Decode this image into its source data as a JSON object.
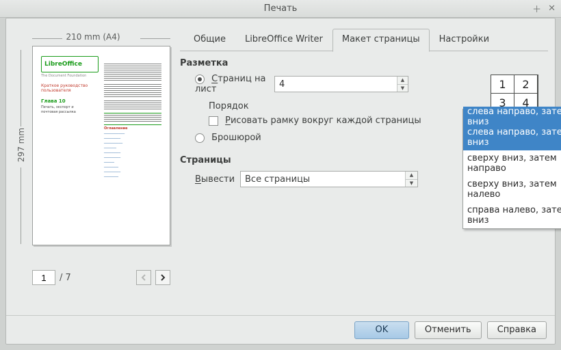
{
  "window": {
    "title": "Печать"
  },
  "preview": {
    "width_label": "210 mm (A4)",
    "height_label": "297 mm",
    "logo": "LibreOffice",
    "logo_sub": "The Document Foundation",
    "red_line": "Краткое руководство пользователя",
    "chapter": "Глава 10",
    "chapter_sub1": "Печать, экспорт и",
    "chapter_sub2": "почтовая рассылка",
    "toc_heading": "Оглавление"
  },
  "pager": {
    "current": "1",
    "total": "/ 7"
  },
  "tabs": {
    "general": "Общие",
    "writer": "LibreOffice Writer",
    "layout": "Макет страницы",
    "options": "Настройки"
  },
  "layout_section": {
    "heading": "Разметка",
    "pages_per_sheet_prefix": "С",
    "pages_per_sheet_rest": "траниц на лист",
    "pages_per_sheet_value": "4",
    "order_label": "Порядок",
    "order_selected": "слева направо, затем вниз",
    "order_options": {
      "o1": "слева направо, затем вниз",
      "o2": "сверху вниз, затем направо",
      "o3": "сверху вниз, затем налево",
      "o4": "справа налево, затем вниз"
    },
    "draw_border_prefix": "Р",
    "draw_border_rest": "исовать рамку вокруг каждой страницы",
    "brochure_label": "Брошюрой",
    "grid": {
      "c1": "1",
      "c2": "2",
      "c3": "3",
      "c4": "4"
    }
  },
  "pages_section": {
    "heading": "Страницы",
    "output_prefix": "В",
    "output_rest": "ывести",
    "output_value": "Все страницы"
  },
  "footer": {
    "ok": "OK",
    "cancel": "Отменить",
    "help": "Справка"
  }
}
